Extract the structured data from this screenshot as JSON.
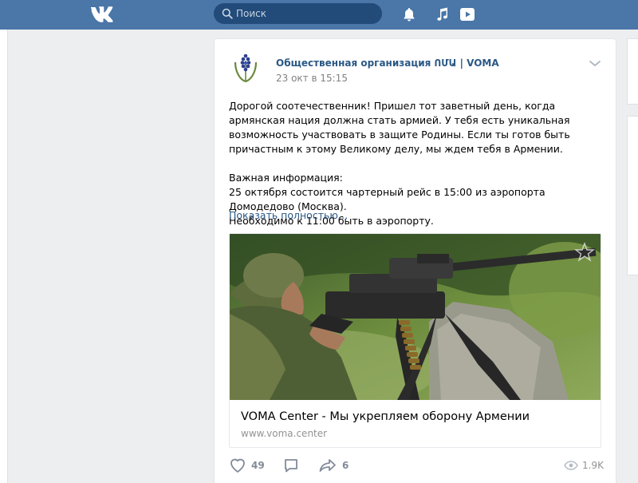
{
  "header": {
    "search": {
      "placeholder": "Поиск"
    },
    "icons": [
      "vk-logo-icon",
      "search-icon",
      "bell-icon",
      "music-icon",
      "video-play-icon"
    ]
  },
  "post": {
    "author": "Общественная организация ՈՄԱ | VOMA",
    "date": "23 окт в 15:15",
    "text_paragraph_1": "Дорогой соотечественник! Пришел тот заветный день, когда армянская нация должна стать армией. У тебя есть уникальная возможность участвовать в защите Родины. Если ты готов быть причастным к этому Великому делу, мы ждем тебя в Армении.",
    "info_heading": "Важная информация:",
    "info_line_1": "25 октября состоится чартерный рейс в 15:00 из аэропорта Домодедово (Москва).",
    "info_line_2": "Необходимо к 11:00 быть в аэропорту.",
    "show_more": "Показать полностью…",
    "link": {
      "title": "VOMA Center - Мы укрепляем оборону Армении",
      "domain": "www.voma.center"
    },
    "likes": "49",
    "shares": "6",
    "views": "1.9K"
  },
  "colors": {
    "header_bg": "#4a76a8",
    "link_blue": "#2a5885",
    "page_bg": "#edeef0",
    "meta_gray": "#828282"
  }
}
